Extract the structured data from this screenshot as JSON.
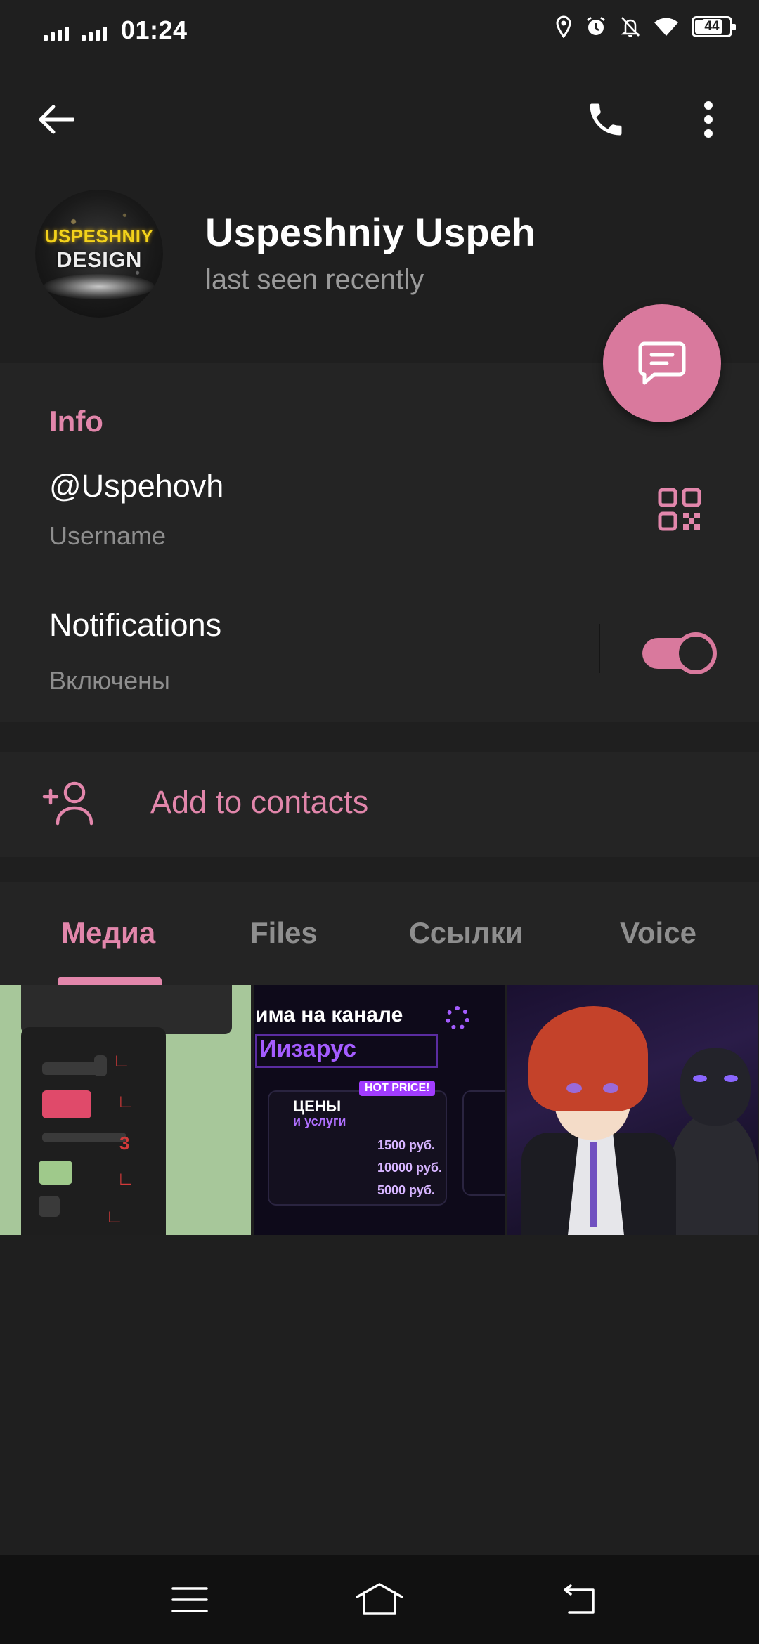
{
  "status_bar": {
    "time": "01:24",
    "battery": "44"
  },
  "profile": {
    "avatar_logo_top": "USPESHNIY",
    "avatar_logo_bottom": "DESIGN",
    "name": "Uspeshniy Uspeh",
    "status": "last seen recently"
  },
  "info": {
    "title": "Info",
    "username_value": "@Uspehovh",
    "username_label": "Username",
    "notifications_title": "Notifications",
    "notifications_sub": "Включены",
    "notifications_enabled": true
  },
  "actions": {
    "add_to_contacts": "Add to contacts"
  },
  "tabs": [
    {
      "label": "Медиа",
      "active": true
    },
    {
      "label": "Files",
      "active": false
    },
    {
      "label": "Ссылки",
      "active": false
    },
    {
      "label": "Voice",
      "active": false
    }
  ],
  "media": {
    "item2_headline": "има на канале",
    "item2_headline2": "Иизарус",
    "item2_badge": "HOT PRICE!",
    "item2_price_title": "ЦЕНЫ",
    "item2_price_sub": "и услуги",
    "item2_prices": [
      "1500 руб.",
      "10000 руб.",
      "5000 руб."
    ]
  },
  "colors": {
    "accent": "#e286ab",
    "fab": "#d9799d",
    "background": "#1f1f1f",
    "section": "#242424"
  },
  "icons": [
    "back-arrow-icon",
    "phone-icon",
    "more-vert-icon",
    "message-icon",
    "qr-code-icon",
    "add-person-icon",
    "menu-icon",
    "home-icon",
    "back-nav-icon"
  ]
}
